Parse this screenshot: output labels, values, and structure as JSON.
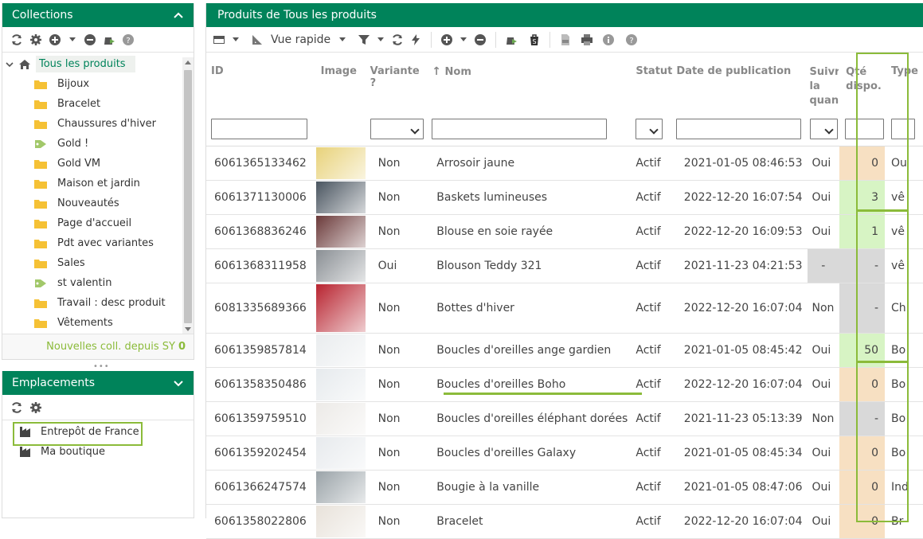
{
  "collections": {
    "title": "Collections",
    "root_label": "Tous les produits",
    "items": [
      {
        "label": "Bijoux",
        "icon": "folder-icon"
      },
      {
        "label": "Bracelet",
        "icon": "folder-icon"
      },
      {
        "label": "Chaussures d'hiver",
        "icon": "folder-icon"
      },
      {
        "label": "Gold !",
        "icon": "tag-icon"
      },
      {
        "label": "Gold VM",
        "icon": "folder-icon"
      },
      {
        "label": "Maison et jardin",
        "icon": "folder-icon"
      },
      {
        "label": "Nouveautés",
        "icon": "folder-icon"
      },
      {
        "label": "Page d'accueil",
        "icon": "folder-icon"
      },
      {
        "label": "Pdt avec variantes",
        "icon": "folder-icon"
      },
      {
        "label": "Sales",
        "icon": "folder-icon"
      },
      {
        "label": "st valentin",
        "icon": "tag-icon"
      },
      {
        "label": "Travail : desc produit",
        "icon": "folder-icon"
      },
      {
        "label": "Vêtements",
        "icon": "folder-icon"
      }
    ],
    "footer_label": "Nouvelles coll. depuis SY",
    "footer_count": "0"
  },
  "emplacements": {
    "title": "Emplacements",
    "items": [
      {
        "label": "Entrepôt de France"
      },
      {
        "label": "Ma boutique"
      }
    ]
  },
  "main": {
    "title": "Produits de Tous les produits",
    "vue_rapide": "Vue rapide",
    "columns": {
      "id": "ID",
      "image": "Image",
      "variante": "Variante ?",
      "nom": "Nom",
      "statut": "Statut",
      "date": "Date de publication",
      "suivre": "Suivre la quantité",
      "qte": "Qté dispo.",
      "type": "Type"
    },
    "rows": [
      {
        "id": "6061365133462",
        "variante": "Non",
        "nom": "Arrosoir jaune",
        "statut": "Actif",
        "date": "2021-01-05 08:46:53",
        "suivre": "Oui",
        "qte": "0",
        "type": "Ou",
        "qstyle": "or",
        "img": "#e8d27a"
      },
      {
        "id": "6061371130006",
        "variante": "Non",
        "nom": "Baskets lumineuses",
        "statut": "Actif",
        "date": "2022-12-20 16:07:54",
        "suivre": "Oui",
        "qte": "3",
        "type": "vê",
        "qstyle": "gr",
        "img": "#4a5560"
      },
      {
        "id": "6061368836246",
        "variante": "Non",
        "nom": "Blouse en soie rayée",
        "statut": "Actif",
        "date": "2022-12-20 16:09:53",
        "suivre": "Oui",
        "qte": "1",
        "type": "vê",
        "qstyle": "gr",
        "img": "#6b3a3a"
      },
      {
        "id": "6061368311958",
        "variante": "Oui",
        "nom": "Blouson Teddy 321",
        "statut": "Actif",
        "date": "2021-11-23 04:21:53",
        "suivre": "-",
        "qte": "-",
        "type": "vê",
        "qstyle": "gy",
        "img": "#8a8f94"
      },
      {
        "id": "6081335689366",
        "variante": "Non",
        "nom": "Bottes d'hiver",
        "statut": "Actif",
        "date": "2022-12-20 16:07:04",
        "suivre": "Non",
        "qte": "-",
        "type": "Ch",
        "qstyle": "gy",
        "img": "#b82430"
      },
      {
        "id": "6061359857814",
        "variante": "Non",
        "nom": "Boucles d'oreilles ange gardien",
        "statut": "Actif",
        "date": "2021-01-05 08:45:42",
        "suivre": "Oui",
        "qte": "50",
        "type": "Bo",
        "qstyle": "gr",
        "img": "#e9ecee"
      },
      {
        "id": "6061358350486",
        "variante": "Non",
        "nom": "Boucles d'oreilles Boho",
        "statut": "Actif",
        "date": "2022-12-20 16:07:04",
        "suivre": "Oui",
        "qte": "0",
        "type": "Bo",
        "qstyle": "or",
        "img": "#e6eaed"
      },
      {
        "id": "6061359759510",
        "variante": "Non",
        "nom": "Boucles d'oreilles éléphant dorées",
        "statut": "Actif",
        "date": "2021-11-23 05:13:39",
        "suivre": "Non",
        "qte": "-",
        "type": "Bo",
        "qstyle": "gy",
        "img": "#eceae7"
      },
      {
        "id": "6061359202454",
        "variante": "Non",
        "nom": "Boucles d'oreilles Galaxy",
        "statut": "Actif",
        "date": "2021-01-05 08:45:34",
        "suivre": "Oui",
        "qte": "0",
        "type": "Bo",
        "qstyle": "or",
        "img": "#e7eaed"
      },
      {
        "id": "6061366247574",
        "variante": "Non",
        "nom": "Bougie à la vanille",
        "statut": "Actif",
        "date": "2021-01-05 08:47:06",
        "suivre": "Oui",
        "qte": "0",
        "type": "Ind",
        "qstyle": "or",
        "img": "#9aa3a8"
      },
      {
        "id": "6061358022806",
        "variante": "Non",
        "nom": "Bracelet",
        "statut": "Actif",
        "date": "2022-12-20 16:07:04",
        "suivre": "Oui",
        "qte": "0",
        "type": "Br",
        "qstyle": "or",
        "img": "#e8e2da"
      }
    ]
  },
  "colors": {
    "brand": "#00835a",
    "highlight": "#8bbb3a",
    "qty_zero": "#f7e0c2",
    "qty_positive": "#d7f4c4",
    "qty_na": "#d9d9d9"
  }
}
